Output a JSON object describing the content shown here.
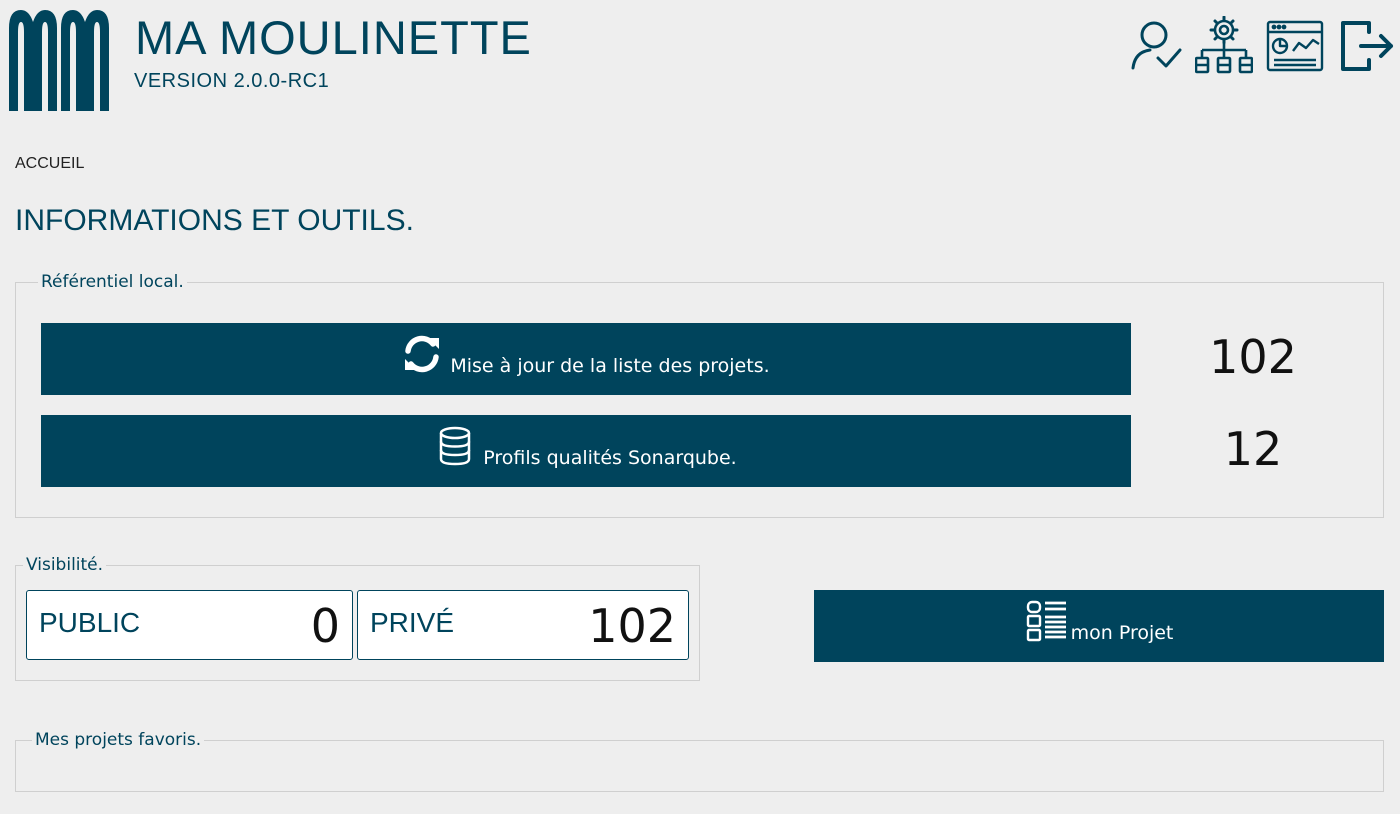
{
  "header": {
    "title": "MA MOULINETTE",
    "version": "VERSION 2.0.0-RC1",
    "logo_text": "MM",
    "icons": [
      "user-check-icon",
      "organization-settings-icon",
      "dashboard-icon",
      "logout-icon"
    ]
  },
  "breadcrumb": "ACCUEIL",
  "page_title": "INFORMATIONS ET OUTILS.",
  "local_repository": {
    "legend": "Référentiel local.",
    "update_button": "Mise à jour de la liste des projets.",
    "update_icon": "sync-icon",
    "project_count": "102",
    "profiles_button": "Profils qualités Sonarqube.",
    "profiles_icon": "database-icon",
    "profiles_count": "12"
  },
  "visibility": {
    "legend": "Visibilité.",
    "public_label": "PUBLIC",
    "public_value": "0",
    "private_label": "PRIVÉ",
    "private_value": "102"
  },
  "project_button": {
    "label": "mon Projet",
    "icon": "project-list-icon"
  },
  "favorites": {
    "legend": "Mes projets favoris."
  },
  "colors": {
    "primary": "#00445c",
    "background": "#eeeeee",
    "border": "#cfcfcf",
    "text_dark": "#111111"
  }
}
